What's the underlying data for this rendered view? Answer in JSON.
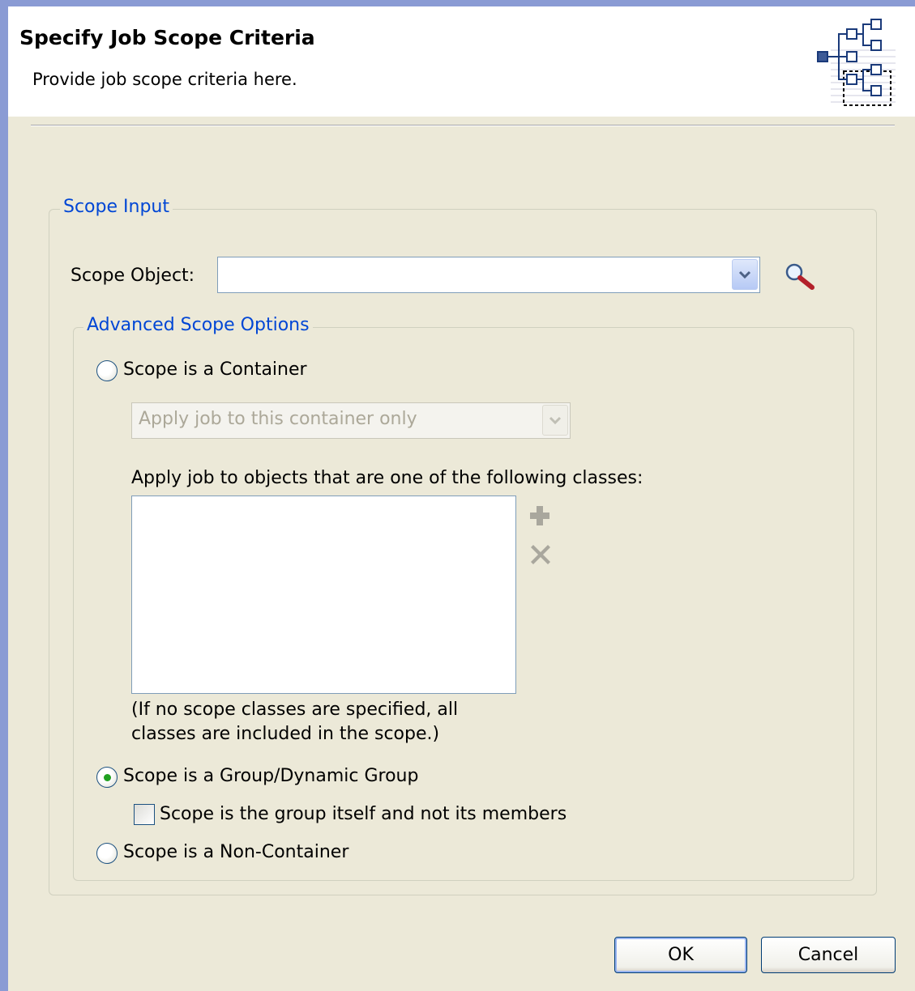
{
  "banner": {
    "title": "Specify Job Scope Criteria",
    "subtitle": "Provide job scope criteria here.",
    "icon": "hierarchy-tree-icon"
  },
  "scope_input": {
    "legend": "Scope Input",
    "scope_object_label": "Scope Object:",
    "scope_object_value": "",
    "browse_icon": "magnifier-icon"
  },
  "advanced": {
    "legend": "Advanced Scope Options",
    "option_container": "Scope is a Container",
    "container_mode": "Apply job to this container only",
    "classes_label": "Apply job to objects that are one of the following classes:",
    "classes": [],
    "add_icon": "plus-icon",
    "remove_icon": "x-delete-icon",
    "note_line1": "(If no scope classes are specified, all",
    "note_line2": "classes are included in the scope.)",
    "option_group": "Scope is a Group/Dynamic Group",
    "group_itself": "Scope is the group itself and not its members",
    "option_noncontainer": "Scope is a Non-Container",
    "selected_option": "Scope is a Group/Dynamic Group",
    "group_itself_checked": false
  },
  "buttons": {
    "ok": "OK",
    "cancel": "Cancel"
  }
}
